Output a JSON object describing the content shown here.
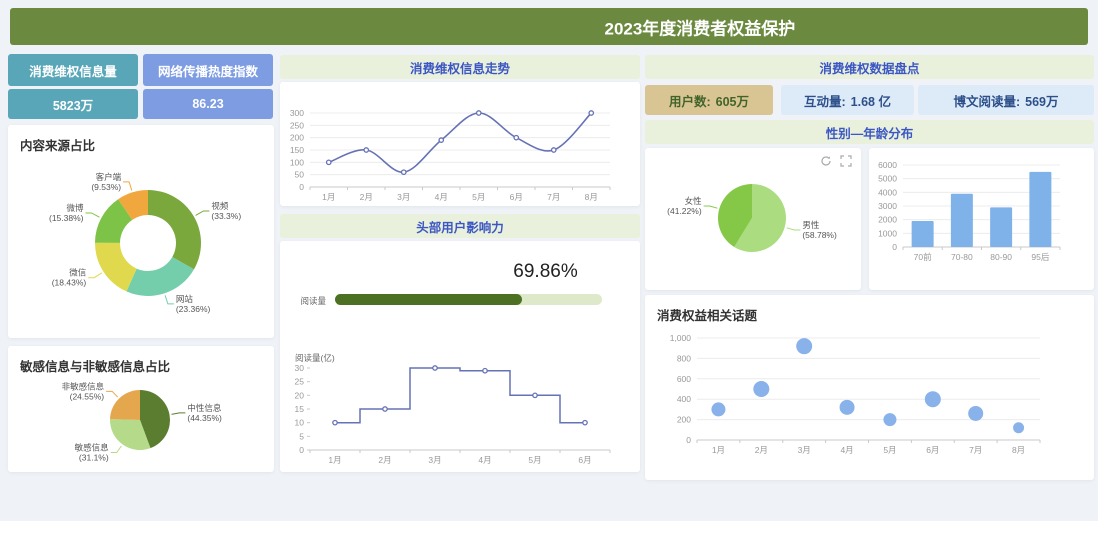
{
  "header": {
    "title": "2023年度消费者权益保护"
  },
  "colors": {
    "header_green": "#6b8a3f",
    "card_teal": "#58a6b8",
    "card_blue": "#7e9ce2",
    "strip_bg": "#e9f1dd",
    "strip_text_blue": "#3c57c4",
    "chip_tan": "#d9c493",
    "chip_light_blue": "#ddebf8",
    "progress_fill": "#4d7123",
    "progress_track": "#dde9c8",
    "line_purple": "#6672b5",
    "bar_blue": "#7fb2e8"
  },
  "left_column": {
    "stat_cards": [
      {
        "label": "消费维权信息量",
        "value": "5823万"
      },
      {
        "label": "网络传播热度指数",
        "value": "86.23"
      }
    ],
    "source_panel_title": "内容来源占比",
    "sensitive_panel_title": "敏感信息与非敏感信息占比"
  },
  "middle_column": {
    "trend_title": "消费维权信息走势",
    "influence_title": "头部用户影响力",
    "influence": {
      "percent": 69.86,
      "percent_label": "69.86%",
      "bar_label": "阅读量"
    }
  },
  "right_column": {
    "overview_title": "消费维权数据盘点",
    "chips": [
      {
        "label": "用户数:",
        "value": "605万"
      },
      {
        "label": "互动量:",
        "value": "1.68 亿"
      },
      {
        "label": "博文阅读量:",
        "value": "569万"
      }
    ],
    "gender_age_title": "性别—年龄分布",
    "toolbox_icons": [
      "refresh-icon",
      "expand-icon"
    ],
    "topics_title": "消费权益相关话题"
  },
  "chart_data": [
    {
      "id": "source_donut",
      "type": "pie",
      "donut": true,
      "title": "内容来源占比",
      "slices": [
        {
          "name": "视频",
          "pct": 33.3,
          "color": "#7aa83c"
        },
        {
          "name": "网站",
          "pct": 23.36,
          "color": "#74ceac"
        },
        {
          "name": "微信",
          "pct": 18.43,
          "color": "#e0d94e"
        },
        {
          "name": "微博",
          "pct": 15.38,
          "color": "#7dc348"
        },
        {
          "name": "客户端",
          "pct": 9.53,
          "color": "#f0a73d"
        }
      ]
    },
    {
      "id": "sensitive_pie",
      "type": "pie",
      "donut": false,
      "title": "敏感信息与非敏感信息占比",
      "slices": [
        {
          "name": "中性信息",
          "pct": 44.35,
          "color": "#5a7d2f"
        },
        {
          "name": "敏感信息",
          "pct": 31.1,
          "color": "#b5da8a"
        },
        {
          "name": "非敏感信息",
          "pct": 24.55,
          "color": "#e5a74e"
        }
      ]
    },
    {
      "id": "trend_line",
      "type": "line",
      "smooth": true,
      "title": "消费维权信息走势",
      "categories": [
        "1月",
        "2月",
        "3月",
        "4月",
        "5月",
        "6月",
        "7月",
        "8月"
      ],
      "values": [
        100,
        150,
        60,
        190,
        300,
        200,
        150,
        300
      ],
      "ylim": [
        0,
        300
      ],
      "ystep": 50,
      "grid": true,
      "color": "#6672b5"
    },
    {
      "id": "influence_progress",
      "type": "bar",
      "title": "头部用户影响力",
      "categories": [
        "阅读量"
      ],
      "values": [
        69.86
      ],
      "unit": "%",
      "ylim": [
        0,
        100
      ]
    },
    {
      "id": "reading_step",
      "type": "line",
      "subtype": "step-middle",
      "ylabel": "阅读量(亿)",
      "categories": [
        "1月",
        "2月",
        "3月",
        "4月",
        "5月",
        "6月"
      ],
      "values": [
        10,
        15,
        30,
        29,
        20,
        10
      ],
      "ylim": [
        0,
        30
      ],
      "ystep": 5,
      "grid": false,
      "color": "#6672b5"
    },
    {
      "id": "gender_pie",
      "type": "pie",
      "donut": false,
      "title": "性别—年龄分布",
      "slices": [
        {
          "name": "男性",
          "pct": 58.78,
          "color": "#abdc80"
        },
        {
          "name": "女性",
          "pct": 41.22,
          "color": "#85c848"
        }
      ]
    },
    {
      "id": "age_bar",
      "type": "bar",
      "categories": [
        "70前",
        "70-80",
        "80-90",
        "95后"
      ],
      "values": [
        1900,
        3900,
        2900,
        5500
      ],
      "ylim": [
        0,
        6000
      ],
      "ystep": 1000,
      "grid": true,
      "color": "#7fb2e8"
    },
    {
      "id": "topics_scatter",
      "type": "scatter",
      "title": "消费权益相关话题",
      "categories": [
        "1月",
        "2月",
        "3月",
        "4月",
        "5月",
        "6月",
        "7月",
        "8月"
      ],
      "values": [
        300,
        500,
        920,
        320,
        200,
        400,
        260,
        120
      ],
      "radii": [
        7,
        8,
        8,
        7.5,
        6.5,
        8,
        7.5,
        5.5
      ],
      "ylim": [
        0,
        1000
      ],
      "ystep": 200,
      "ytick_labels": [
        "0",
        "200",
        "400",
        "600",
        "800",
        "1,000"
      ],
      "grid": true,
      "color": "#82aee8"
    }
  ]
}
